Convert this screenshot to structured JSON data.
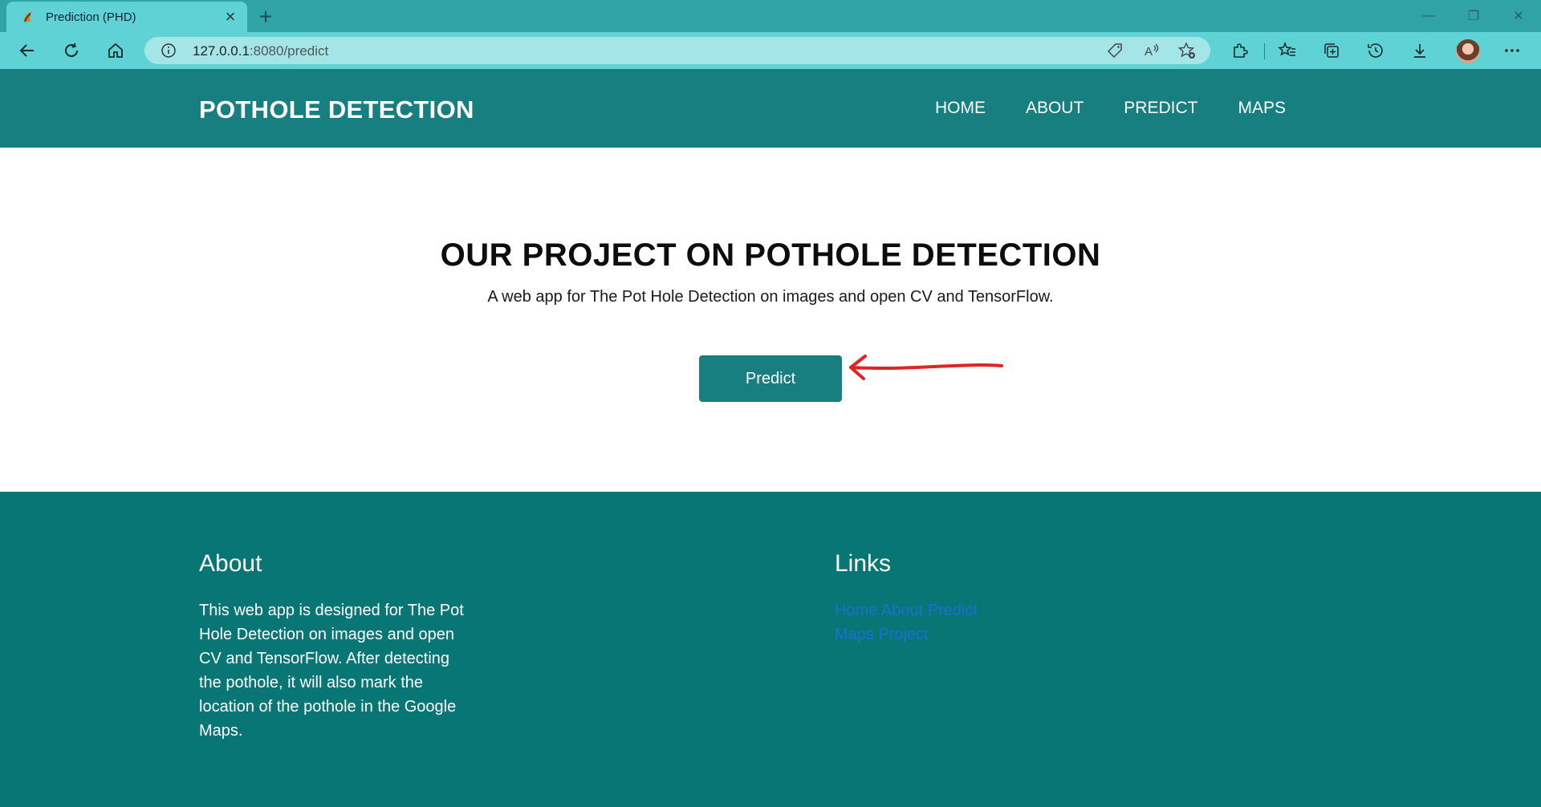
{
  "browser": {
    "tab_title": "Prediction (PHD)",
    "new_tab_label": "+",
    "close_tab_label": "×",
    "url_host": "127.0.0.1",
    "url_rest": ":8080/predict",
    "window_controls": [
      "—",
      "❐",
      "✕"
    ],
    "accent": "#5fd2d6"
  },
  "header": {
    "brand": "POTHOLE DETECTION",
    "nav": [
      "HOME",
      "ABOUT",
      "PREDICT",
      "MAPS"
    ],
    "background": "#177f80"
  },
  "hero": {
    "title": "OUR PROJECT ON POTHOLE DETECTION",
    "subtitle": "A web app for The Pot Hole Detection on images and open CV and TensorFlow.",
    "button_label": "Predict",
    "annotation_color": "#e02424"
  },
  "footer": {
    "about_heading": "About",
    "about_text": "This web app is designed for The Pot Hole Detection on images and open CV and TensorFlow. After detecting the pothole, it will also mark the location of the pothole in the Google Maps.",
    "links_heading": "Links",
    "links": [
      "Home",
      "About",
      "Predict",
      "Maps",
      "Project"
    ],
    "background": "#097676",
    "link_color": "#1a6fd4"
  }
}
